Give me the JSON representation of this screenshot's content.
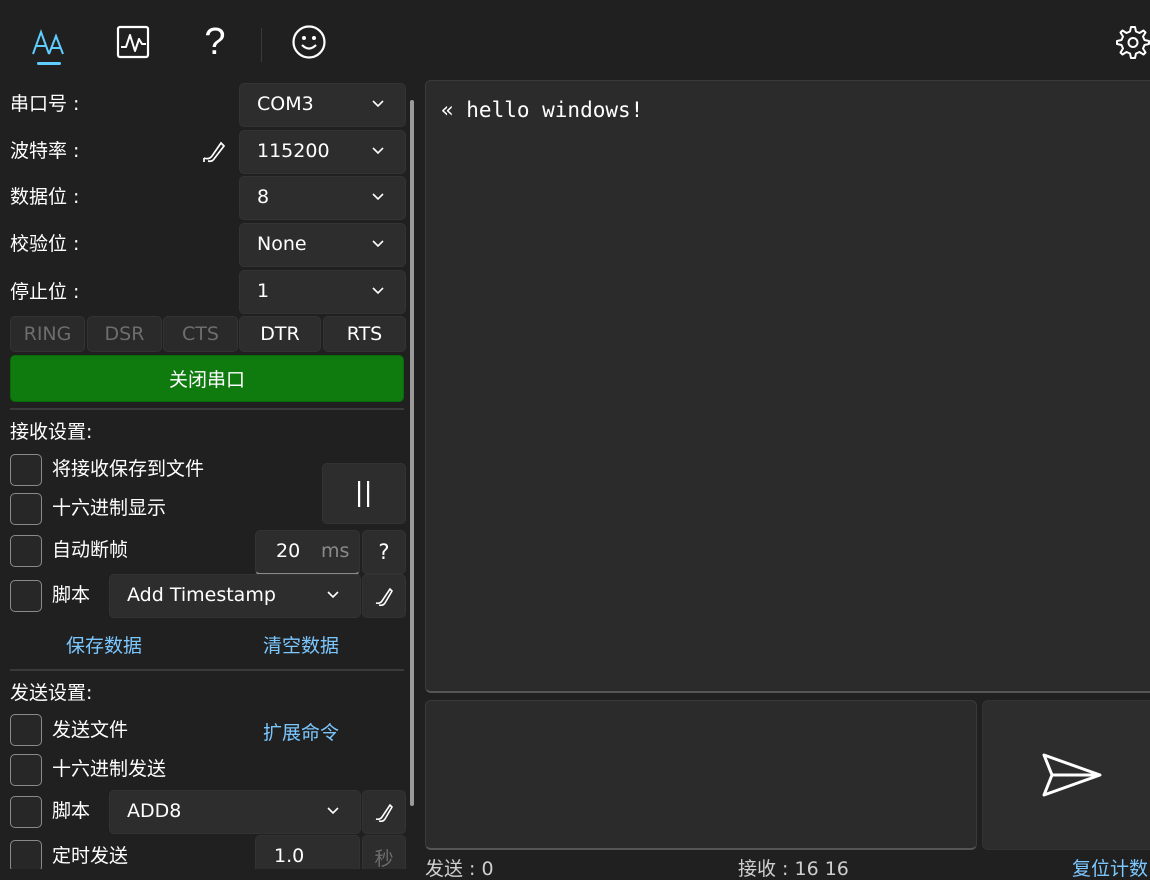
{
  "toolbar": {
    "items": [
      {
        "name": "font-icon"
      },
      {
        "name": "waveform-icon"
      },
      {
        "name": "help-icon",
        "glyph": "?"
      },
      {
        "name": "smiley-icon"
      }
    ],
    "settings": {
      "name": "gear-icon"
    }
  },
  "serial": {
    "port_label": "串口号 :",
    "port_value": "COM3",
    "baud_label": "波特率 :",
    "baud_value": "115200",
    "databits_label": "数据位 :",
    "databits_value": "8",
    "parity_label": "校验位 :",
    "parity_value": "None",
    "stopbits_label": "停止位 :",
    "stopbits_value": "1"
  },
  "pins": [
    "RING",
    "DSR",
    "CTS",
    "DTR",
    "RTS"
  ],
  "close_port_label": "关闭串口",
  "receive": {
    "section_label": "接收设置:",
    "save_to_file": "将接收保存到文件",
    "hex_display": "十六进制显示",
    "auto_frame": "自动断帧",
    "frame_value": "20",
    "frame_unit": "ms",
    "frame_help": "?",
    "script_label": "脚本",
    "script_value": "Add Timestamp",
    "save_data": "保存数据",
    "clear_data": "清空数据"
  },
  "send": {
    "section_label": "发送设置:",
    "send_file": "发送文件",
    "extend_cmd": "扩展命令",
    "hex_send": "十六进制发送",
    "script_label": "脚本",
    "script_value": "ADD8",
    "timed_send": "定时发送",
    "timer_value": "1.0",
    "timer_unit": "秒"
  },
  "output": {
    "text": "« hello windows!"
  },
  "status": {
    "sent": "发送 : 0",
    "received": "接收 : 16     16",
    "reset": "复位计数"
  },
  "colors": {
    "accent": "#60cdff",
    "open_port": "#0f7b0f",
    "link": "#7cc7ff"
  }
}
